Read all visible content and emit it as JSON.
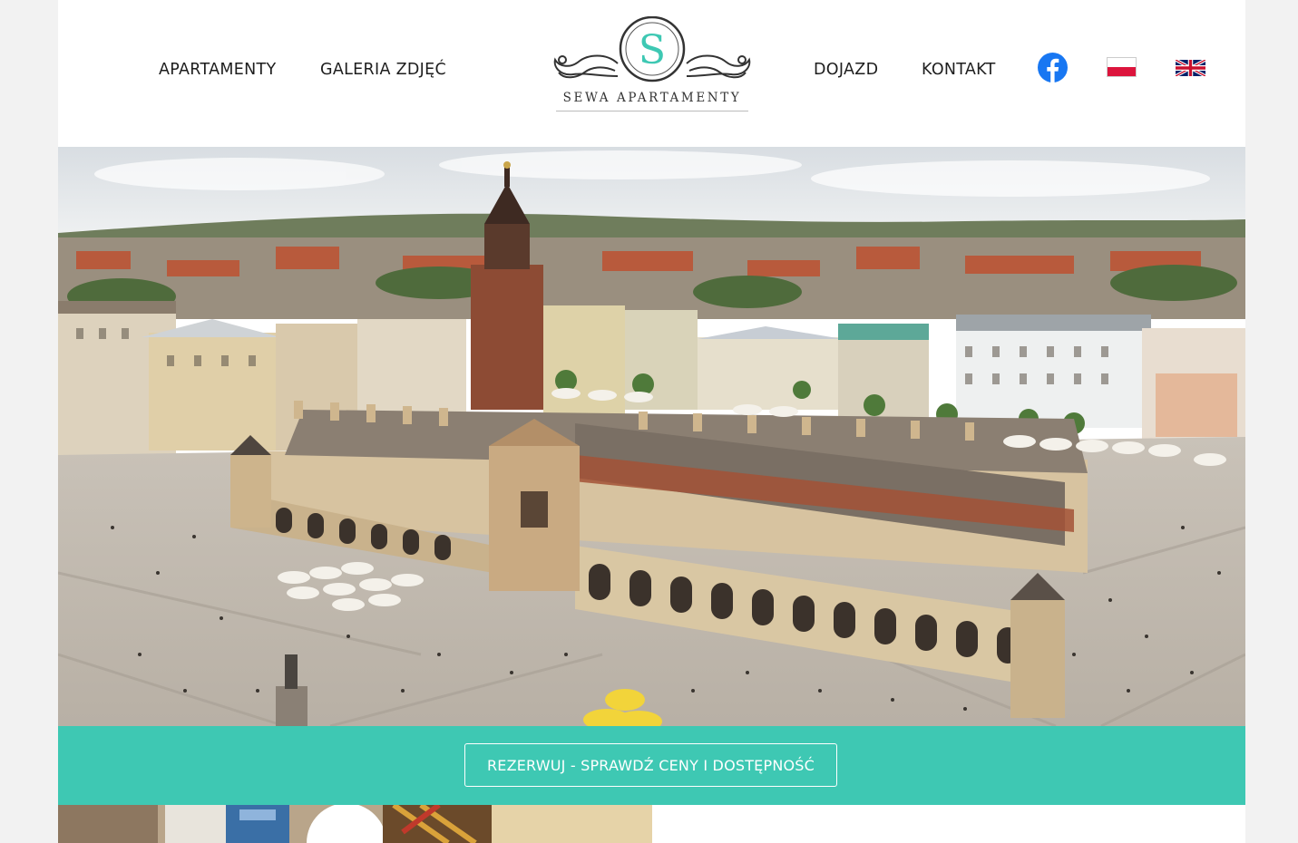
{
  "nav": {
    "left": [
      "APARTAMENTY",
      "GALERIA ZDJĘĆ"
    ],
    "right": [
      "DOJAZD",
      "KONTAKT"
    ]
  },
  "logo": {
    "letter": "S",
    "text": "SEWA APARTAMENTY",
    "accent": "#3ec8b3"
  },
  "social": {
    "icon": "facebook-icon",
    "color": "#1877f2"
  },
  "languages": [
    {
      "icon": "flag-pl-icon",
      "code": "pl"
    },
    {
      "icon": "flag-gb-icon",
      "code": "en"
    }
  ],
  "hero": {
    "icon": "hero-photo-krakow-main-square"
  },
  "booking": {
    "button_label": "REZERWUJ - SPRAWDŹ CENY I DOSTĘPNOŚĆ",
    "bar_color": "#3ec8b3"
  }
}
